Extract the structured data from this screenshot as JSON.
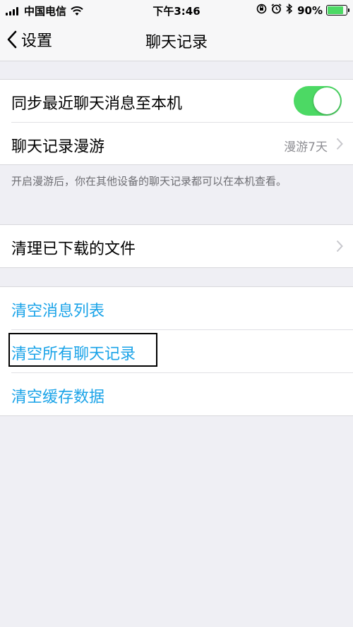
{
  "status_bar": {
    "carrier": "中国电信",
    "time": "下午3:46",
    "battery_percent": "90%"
  },
  "nav": {
    "back_label": "设置",
    "title": "聊天记录"
  },
  "sync_group": {
    "sync_label": "同步最近聊天消息至本机",
    "sync_enabled": true,
    "roaming_label": "聊天记录漫游",
    "roaming_value": "漫游7天",
    "footnote": "开启漫游后，你在其他设备的聊天记录都可以在本机查看。"
  },
  "files_group": {
    "clean_label": "清理已下载的文件"
  },
  "clear_group": {
    "clear_message_list": "清空消息列表",
    "clear_all_chats": "清空所有聊天记录",
    "clear_cache": "清空缓存数据"
  },
  "colors": {
    "accent": "#1aa3e8",
    "toggle_on": "#4cd964"
  }
}
